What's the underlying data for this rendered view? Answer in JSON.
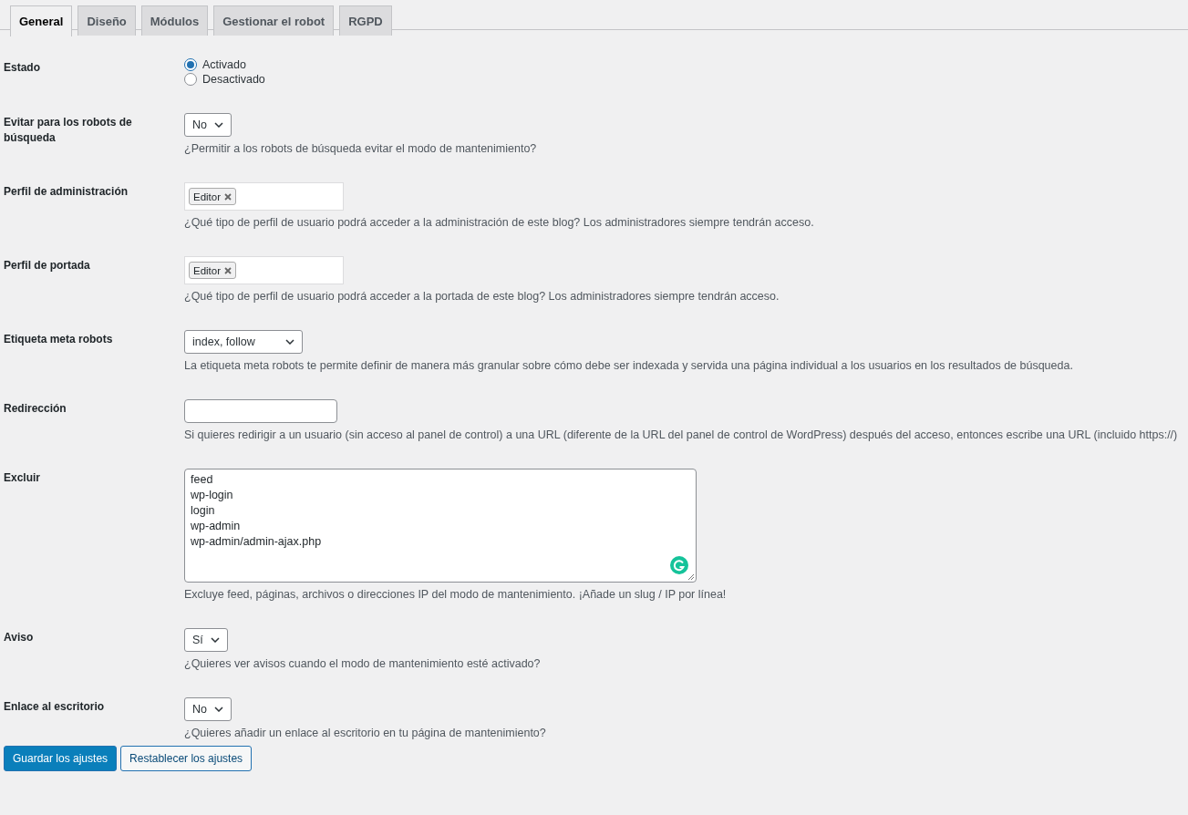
{
  "tabs": [
    {
      "label": "General",
      "selected": true
    },
    {
      "label": "Diseño",
      "selected": false
    },
    {
      "label": "Módulos",
      "selected": false
    },
    {
      "label": "Gestionar el robot",
      "selected": false
    },
    {
      "label": "RGPD",
      "selected": false
    }
  ],
  "settings": [
    {
      "kind": "radio",
      "label": "Estado",
      "options": [
        {
          "label": "Activado",
          "selected": true
        },
        {
          "label": "Desactivado",
          "selected": false
        }
      ]
    },
    {
      "kind": "select",
      "label": "Evitar para los robots de búsqueda",
      "value": "No",
      "description": "¿Permitir a los robots de búsqueda evitar el modo de mantenimiento?"
    },
    {
      "kind": "tags",
      "label": "Perfil de administración",
      "tags": [
        "Editor"
      ],
      "description": "¿Qué tipo de perfil de usuario podrá acceder a la administración de este blog? Los administradores siempre tendrán acceso."
    },
    {
      "kind": "tags",
      "label": "Perfil de portada",
      "tags": [
        "Editor"
      ],
      "description": "¿Qué tipo de perfil de usuario podrá acceder a la portada de este blog? Los administradores siempre tendrán acceso."
    },
    {
      "kind": "select",
      "label": "Etiqueta meta robots",
      "value": "index, follow",
      "description": "La etiqueta meta robots te permite definir de manera más granular sobre cómo debe ser indexada y servida una página individual a los usuarios en los resultados de búsqueda."
    },
    {
      "kind": "text",
      "label": "Redirección",
      "description": "Si quieres redirigir a un usuario (sin acceso al panel de control) a una URL (diferente de la URL del panel de control de WordPress) después del acceso, entonces escribe una URL (incluido https://)"
    },
    {
      "kind": "textarea",
      "label": "Excluir",
      "lines": [
        "feed",
        "wp-login",
        "login",
        "wp-admin",
        "wp-admin/admin-ajax.php"
      ],
      "description": "Excluye feed, páginas, archivos o direcciones IP del modo de mantenimiento. ¡Añade un slug / IP por línea!"
    },
    {
      "kind": "select",
      "label": "Aviso",
      "value": "Sí",
      "description": "¿Quieres ver avisos cuando el modo de mantenimiento esté activado?"
    },
    {
      "kind": "select",
      "label": "Enlace al escritorio",
      "value": "No",
      "description": "¿Quieres añadir un enlace al escritorio en tu página de mantenimiento?"
    }
  ],
  "buttons": [
    {
      "label": "Guardar los ajustes",
      "kind": "primary"
    },
    {
      "label": "Restablecer los ajustes",
      "kind": "secondary"
    }
  ]
}
